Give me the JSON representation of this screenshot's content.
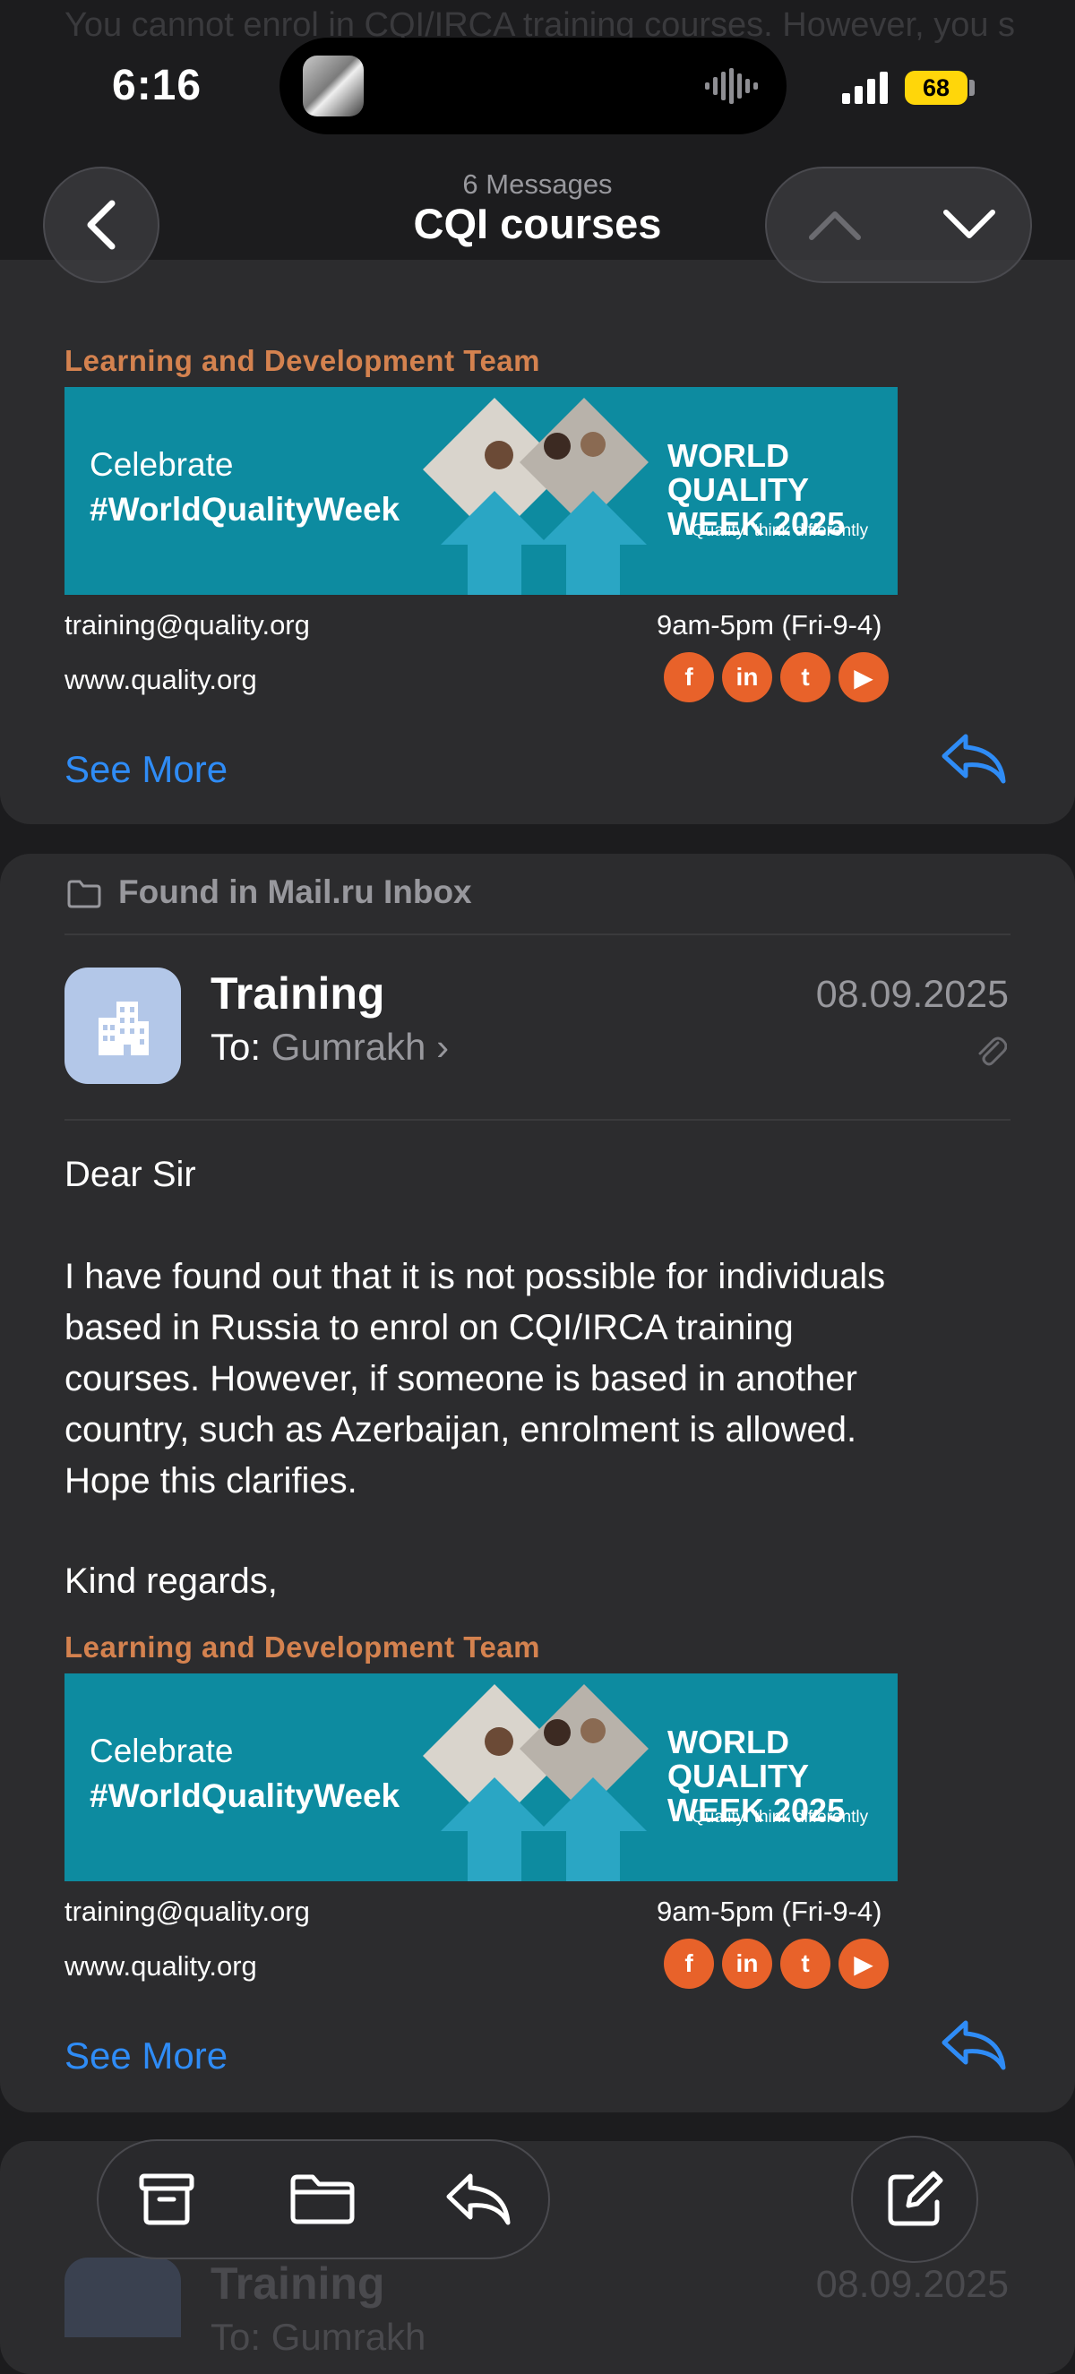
{
  "status": {
    "time": "6:16",
    "battery": "68"
  },
  "nav": {
    "counter": "6 Messages",
    "title": "CQI courses"
  },
  "background": {
    "ghost_line": "You cannot enrol in CQI/IRCA training courses. However, you should"
  },
  "signature": {
    "team": "Learning and Development Team",
    "banner_celebrate": "Celebrate",
    "banner_hashtag": "#WorldQualityWeek",
    "banner_world": "WORLD",
    "banner_quality_week": "QUALITY WEEK 2025",
    "banner_tagline": "Quality: think differently",
    "email": "training@quality.org",
    "hours": "9am-5pm (Fri-9-4)",
    "website": "www.quality.org"
  },
  "actions": {
    "see_more": "See More"
  },
  "message": {
    "mailbox_note": "Found in Mail.ru Inbox",
    "sender": "Training",
    "to_label": "To:",
    "to_name": "Gumrakh",
    "date": "08.09.2025",
    "greeting": "Dear Sir",
    "paragraph_lines": [
      "I have found out that it is not possible for individuals",
      "based in Russia to enrol on CQI/IRCA training",
      "courses. However, if someone is based in another",
      "country, such as Azerbaijan, enrolment is allowed.",
      "Hope this clarifies."
    ],
    "closing": "Kind regards,"
  },
  "next_message": {
    "sender": "Training",
    "date": "08.09.2025",
    "to_label": "To:",
    "to_name": "Gumrakh"
  },
  "colors": {
    "accent": "#2f8cf6",
    "team": "#d4824f",
    "banner": "#0d8ba0"
  }
}
